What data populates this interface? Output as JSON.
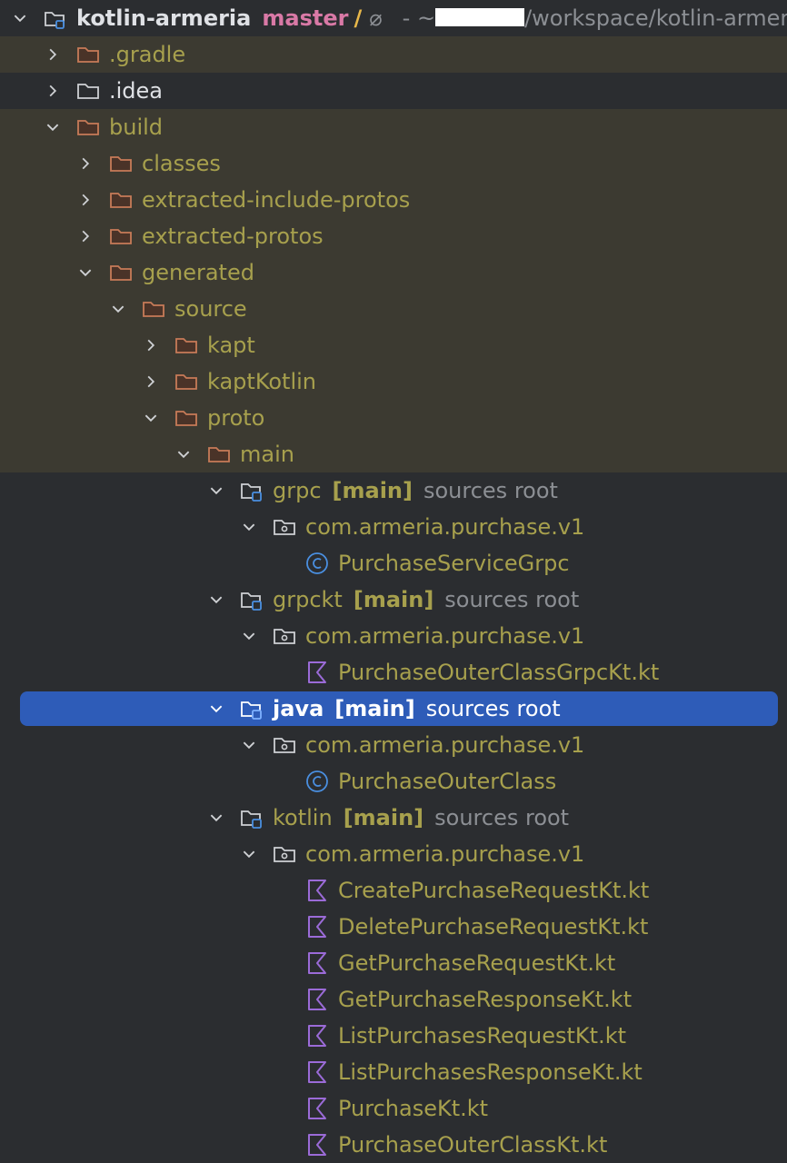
{
  "root": {
    "name": "kotlin-armeria",
    "branch": "master",
    "branch_symbol": "/",
    "sync_symbol": "⌀",
    "path_prefix": "- ~",
    "path_suffix": "/workspace/kotlin-armeria"
  },
  "tree": {
    "gradle": ".gradle",
    "idea": ".idea",
    "build": "build",
    "classes": "classes",
    "extracted_include_protos": "extracted-include-protos",
    "extracted_protos": "extracted-protos",
    "generated": "generated",
    "source": "source",
    "kapt": "kapt",
    "kaptKotlin": "kaptKotlin",
    "proto": "proto",
    "main": "main",
    "main_tag": "[main]",
    "sources_root": "sources root",
    "grpc": "grpc",
    "grpc_pkg": "com.armeria.purchase.v1",
    "grpc_class": "PurchaseServiceGrpc",
    "grpckt": "grpckt",
    "grpckt_pkg": "com.armeria.purchase.v1",
    "grpckt_file": "PurchaseOuterClassGrpcKt.kt",
    "java": "java",
    "java_pkg": "com.armeria.purchase.v1",
    "java_class": "PurchaseOuterClass",
    "kotlin": "kotlin",
    "kotlin_pkg": "com.armeria.purchase.v1",
    "kotlin_files": [
      "CreatePurchaseRequestKt.kt",
      "DeletePurchaseRequestKt.kt",
      "GetPurchaseRequestKt.kt",
      "GetPurchaseResponseKt.kt",
      "ListPurchasesRequestKt.kt",
      "ListPurchasesResponseKt.kt",
      "PurchaseKt.kt",
      "PurchaseOuterClassKt.kt"
    ]
  },
  "colors": {
    "background": "#2b2d30",
    "excluded_background": "#3c3a31",
    "selection": "#2e5cb8",
    "excluded_text": "#a7a04d",
    "folder_excluded": "#c77b58",
    "kotlin_icon": "#9b6bd8",
    "class_icon": "#4a8fe0",
    "branch": "#d979a6"
  }
}
